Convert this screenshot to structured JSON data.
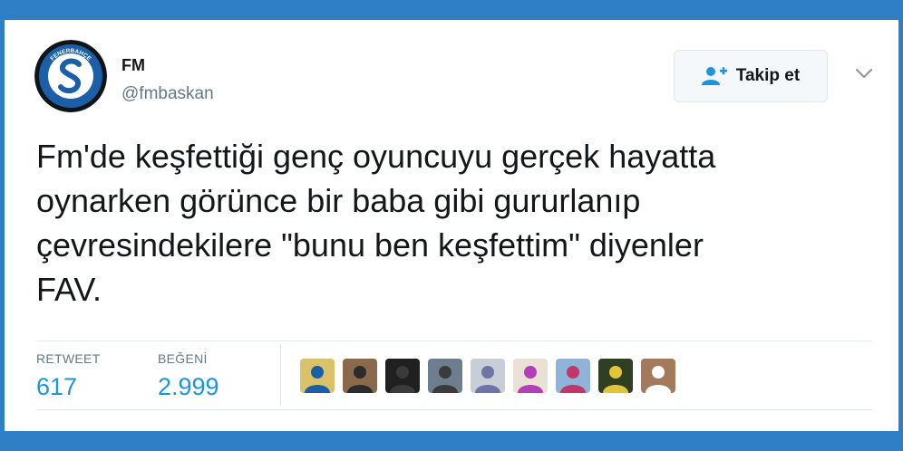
{
  "user": {
    "display_name": "FM",
    "handle": "@fmbaskan",
    "avatar_icon": "fm-logo-icon",
    "avatar_text": "FENERBAHÇE"
  },
  "follow_button": {
    "label": "Takip et",
    "icon": "user-add-icon"
  },
  "more_options_icon": "chevron-down-icon",
  "tweet": {
    "lines": [
      "Fm'de keşfettiği genç oyuncuyu gerçek hayatta",
      "oynarken görünce bir baba gibi gururlanıp",
      "çevresindekilere \"bunu ben keşfettim\" diyenler",
      "FAV."
    ]
  },
  "stats": {
    "retweet_label": "RETWEET",
    "retweet_count": "617",
    "like_label": "BEĞENİ",
    "like_count": "2.999"
  },
  "likers": [
    {
      "icon": "avatar-1",
      "bg": "#d9c26a",
      "fg": "#1b5ea8"
    },
    {
      "icon": "avatar-2",
      "bg": "#8a6a4a",
      "fg": "#2c2c2c"
    },
    {
      "icon": "avatar-3",
      "bg": "#202020",
      "fg": "#3a3a3a"
    },
    {
      "icon": "avatar-4",
      "bg": "#6d7f8e",
      "fg": "#3b3b3b"
    },
    {
      "icon": "avatar-5",
      "bg": "#c8cdd6",
      "fg": "#6e74a8"
    },
    {
      "icon": "avatar-6",
      "bg": "#e9e0d6",
      "fg": "#b23fb8"
    },
    {
      "icon": "avatar-7",
      "bg": "#8fb3d9",
      "fg": "#c1376a"
    },
    {
      "icon": "avatar-8",
      "bg": "#2f3f22",
      "fg": "#e2c43a"
    },
    {
      "icon": "avatar-9",
      "bg": "#a37a5c",
      "fg": "#ffffff"
    }
  ],
  "colors": {
    "frame": "#2e7fc5",
    "accent": "#1b95e0",
    "text": "#14171a",
    "muted": "#657786"
  }
}
